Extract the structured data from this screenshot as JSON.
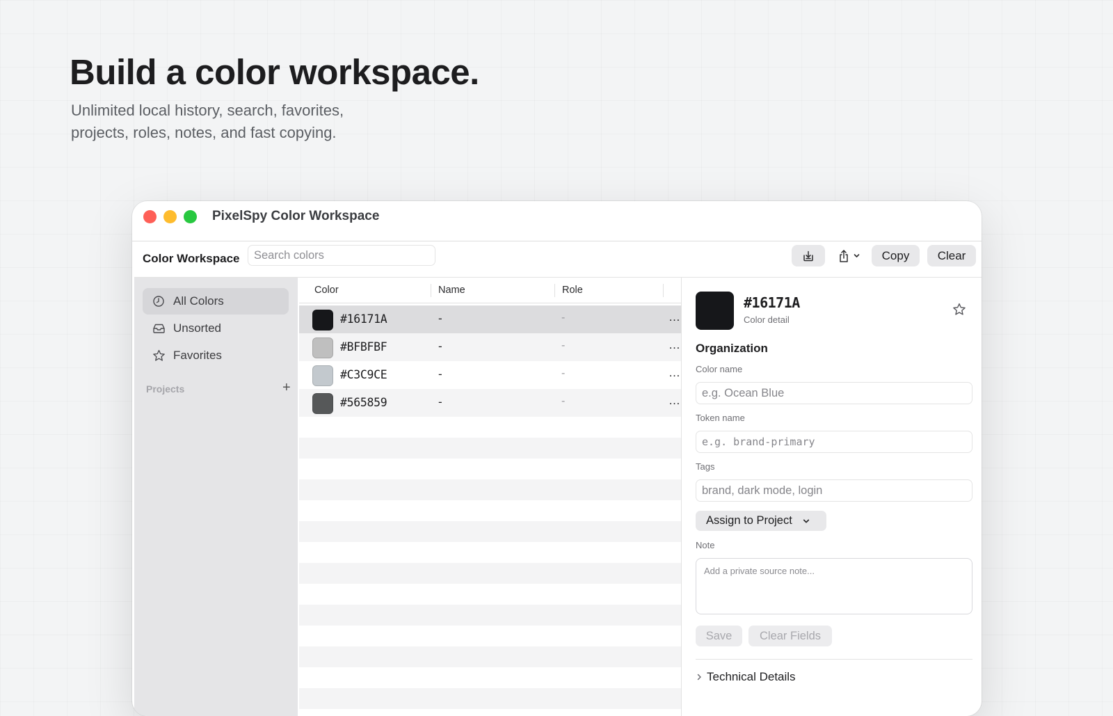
{
  "hero": {
    "title": "Build a color workspace.",
    "subtitle_line1": "Unlimited local history, search, favorites,",
    "subtitle_line2": "projects, roles, notes, and fast copying."
  },
  "window": {
    "title": "PixelSpy Color Workspace"
  },
  "toolbar": {
    "workspace_label": "Color Workspace",
    "search_placeholder": "Search colors",
    "import_icon": "tray-download-icon",
    "share_icon": "share-icon",
    "copy_label": "Copy",
    "clear_label": "Clear"
  },
  "sidebar": {
    "items": [
      {
        "label": "All Colors",
        "icon": "clock-icon",
        "active": true
      },
      {
        "label": "Unsorted",
        "icon": "inbox-icon",
        "active": false
      },
      {
        "label": "Favorites",
        "icon": "star-icon",
        "active": false
      }
    ],
    "projects_label": "Projects",
    "add_project_label": "+"
  },
  "table": {
    "columns": [
      "Color",
      "Name",
      "Role"
    ],
    "rows": [
      {
        "color": "#16171A",
        "hex": "#16171A",
        "name": "-",
        "role": "-",
        "more": "…",
        "selected": true
      },
      {
        "color": "#BFBFBF",
        "hex": "#BFBFBF",
        "name": "-",
        "role": "-",
        "more": "…",
        "selected": false
      },
      {
        "color": "#C3C9CE",
        "hex": "#C3C9CE",
        "name": "-",
        "role": "-",
        "more": "…",
        "selected": false
      },
      {
        "color": "#565859",
        "hex": "#565859",
        "name": "-",
        "role": "-",
        "more": "…",
        "selected": false
      }
    ]
  },
  "detail": {
    "swatch_color": "#16171A",
    "hex": "#16171A",
    "subtitle": "Color detail",
    "organization_heading": "Organization",
    "color_name_label": "Color name",
    "color_name_placeholder": "e.g. Ocean Blue",
    "token_name_label": "Token name",
    "token_name_placeholder": "e.g. brand-primary",
    "tags_label": "Tags",
    "tags_placeholder": "brand, dark mode, login",
    "assign_label": "Assign to Project",
    "note_label": "Note",
    "note_placeholder": "Add a private source note...",
    "save_label": "Save",
    "clear_fields_label": "Clear Fields",
    "technical_details_label": "Technical Details"
  }
}
